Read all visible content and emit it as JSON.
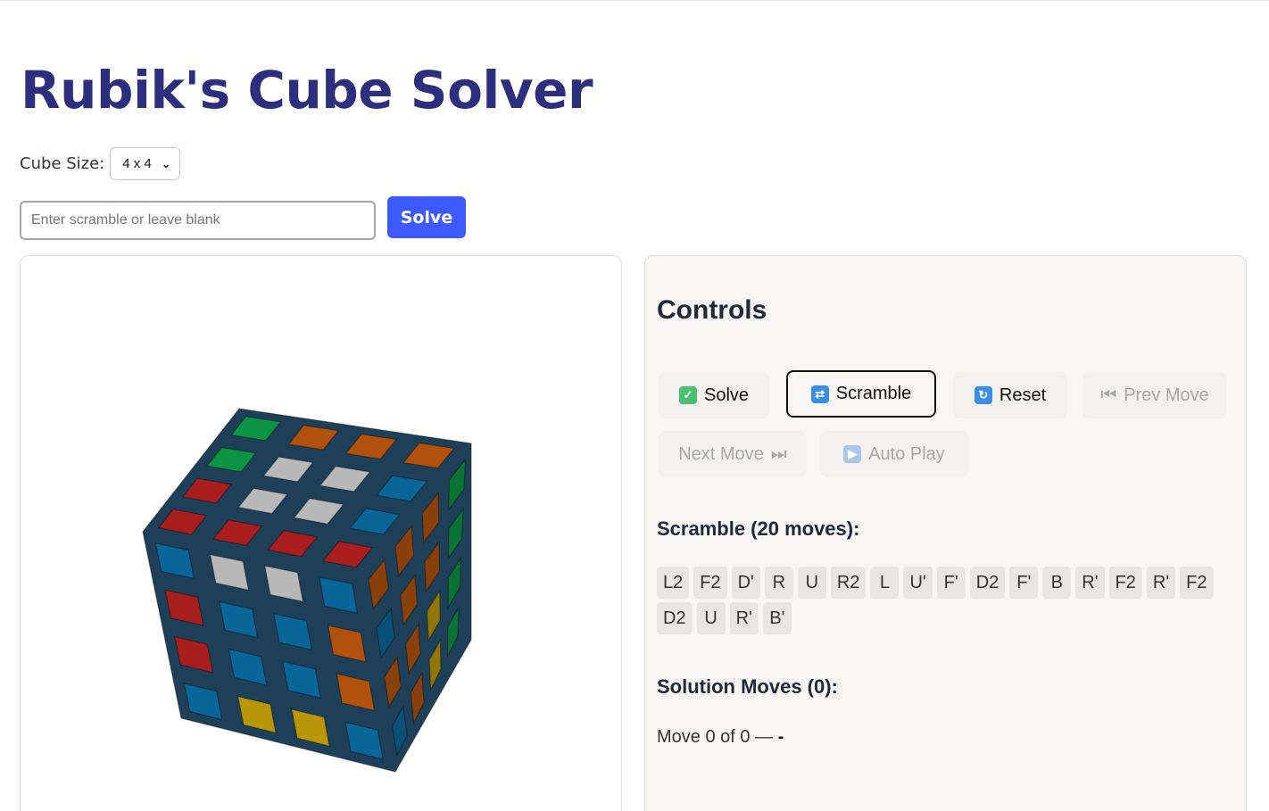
{
  "title": "Rubik's Cube Solver",
  "cube_size": {
    "label": "Cube Size:",
    "value": "4 x 4"
  },
  "scramble_input": {
    "placeholder": "Enter scramble or leave blank",
    "value": ""
  },
  "solve_button_label": "Solve",
  "controls": {
    "title": "Controls",
    "buttons": {
      "solve": "Solve",
      "scramble": "Scramble",
      "reset": "Reset",
      "prev": "Prev Move",
      "next": "Next Move",
      "autoplay": "Auto Play"
    },
    "scramble_heading": "Scramble (20 moves):",
    "scramble_moves": [
      "L2",
      "F2",
      "D'",
      "R",
      "U",
      "R2",
      "L",
      "U'",
      "F'",
      "D2",
      "F'",
      "B",
      "R'",
      "F2",
      "R'",
      "F2",
      "D2",
      "U",
      "R'",
      "B'"
    ],
    "solution_heading": "Solution Moves (0):",
    "status_prefix": "Move 0 of 0 —",
    "status_current": "-"
  },
  "cube_colors": {
    "red": "#a81e1e",
    "green": "#0a9444",
    "orange": "#b0520e",
    "white": "#b8b8b8",
    "blue": "#0a6699",
    "yellow": "#b8960a"
  },
  "accent": "#3d5afe",
  "title_color": "#2e2e7e"
}
